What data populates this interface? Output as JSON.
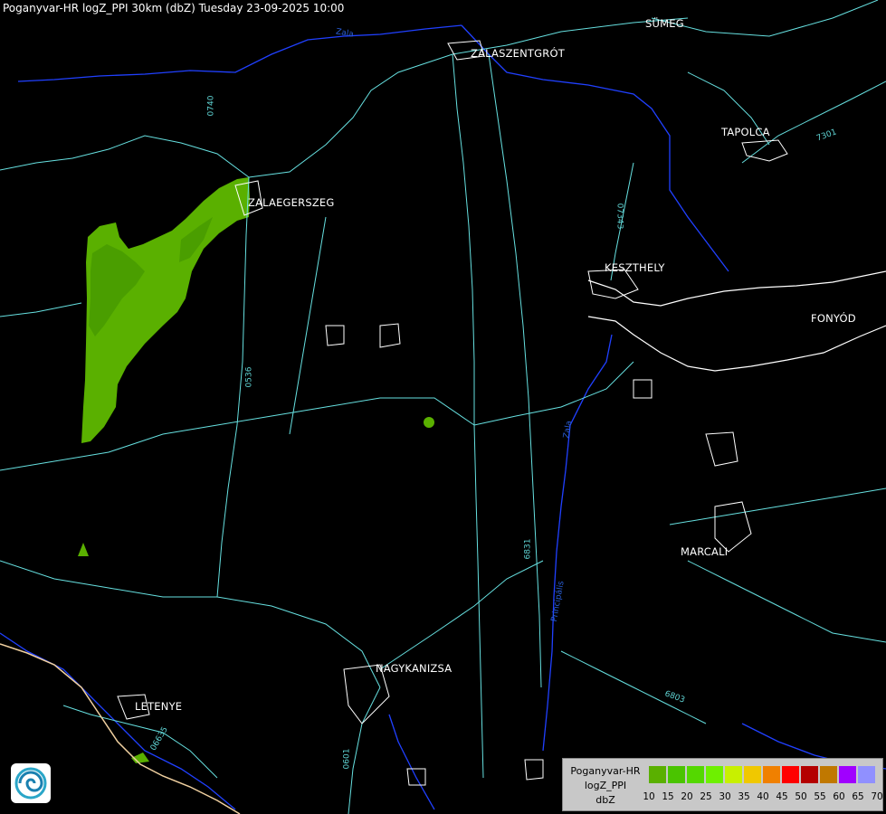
{
  "header": {
    "title": "Poganyvar-HR logZ_PPI 30km (dbZ) Tuesday 23-09-2025 10:00"
  },
  "cities": [
    {
      "name": "SÜMEG"
    },
    {
      "name": "ZALASZENTGRÓT"
    },
    {
      "name": "TAPOLCA"
    },
    {
      "name": "ZALAEGERSZEG"
    },
    {
      "name": "KESZTHELY"
    },
    {
      "name": "FONYÓD"
    },
    {
      "name": "MARCALI"
    },
    {
      "name": "NAGYKANIZSA"
    },
    {
      "name": "LETENYE"
    }
  ],
  "road_labels": [
    "0740",
    "07343",
    "0536",
    "6831",
    "6803",
    "06635",
    "0601",
    "7301"
  ],
  "river_labels": [
    "Zala",
    "Zala",
    "Principális"
  ],
  "legend": {
    "line1": "Poganyvar-HR",
    "line2": "logZ_PPI",
    "line3": "dbZ",
    "ticks": [
      "10",
      "15",
      "20",
      "25",
      "30",
      "35",
      "40",
      "45",
      "50",
      "55",
      "60",
      "65",
      "70"
    ],
    "colors": [
      "#5ab000",
      "#4ac400",
      "#54d800",
      "#6ef000",
      "#c8f000",
      "#f0c800",
      "#f08000",
      "#ff0000",
      "#b40000",
      "#c07800",
      "#a000ff",
      "#9090ff"
    ]
  },
  "colors": {
    "background": "#000000",
    "roads": "#66e0e0",
    "rivers": "#2040ff",
    "border": "#f0d0a0",
    "echo_light": "#5ab000",
    "echo_dark": "#3c8a00"
  }
}
